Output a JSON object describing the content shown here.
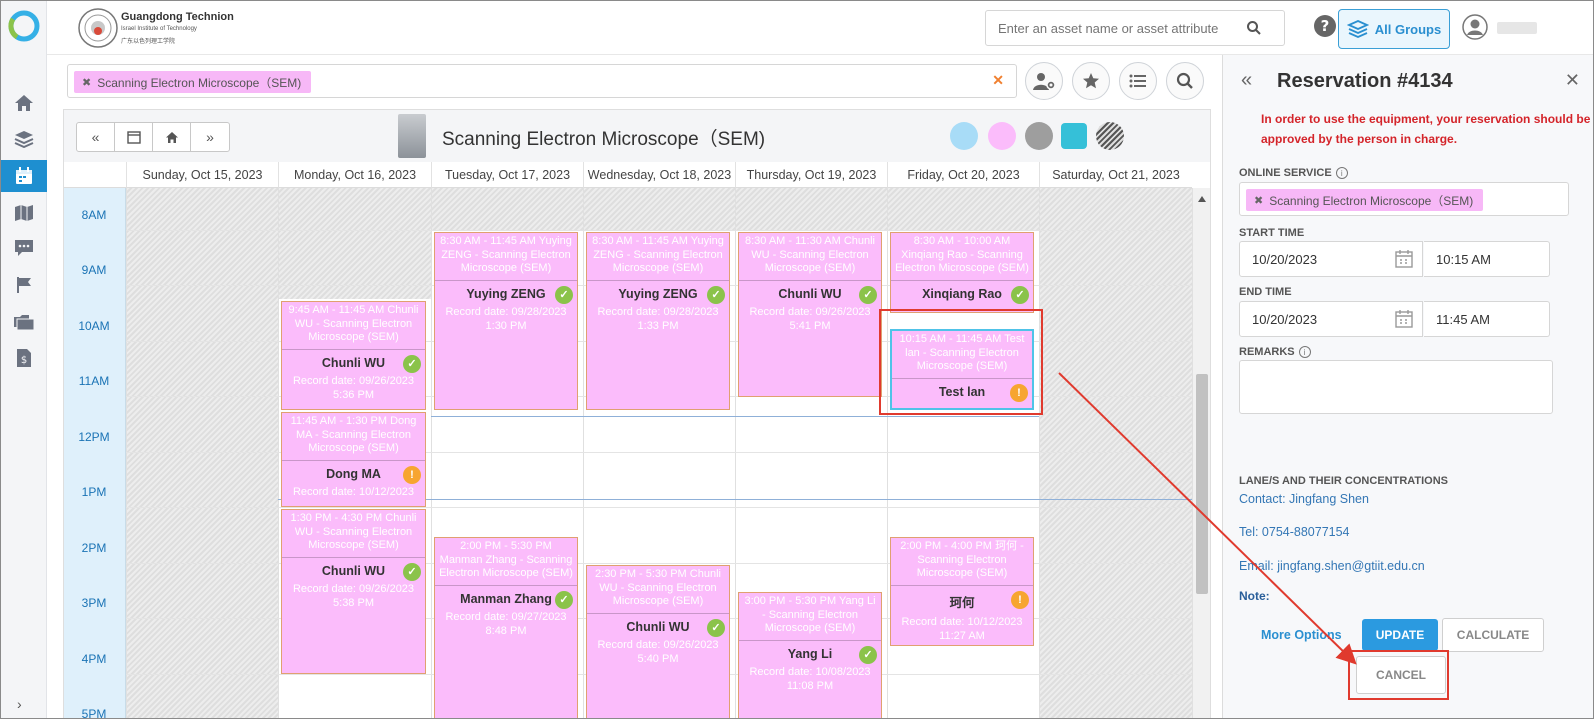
{
  "header": {
    "org_name": "Guangdong Technion",
    "org_sub1": "Israel Institute of Technology",
    "org_sub2": "广东以色列理工学院",
    "search_placeholder": "Enter an asset name or asset attribute",
    "groups_label": "All Groups"
  },
  "filter": {
    "chip_label": "Scanning Electron Microscope（SEM)"
  },
  "calendar": {
    "resource_title": "Scanning Electron Microscope（SEM)",
    "legend_colors": [
      "#a8dcf7",
      "#fbbcfb",
      "#9e9e9e",
      "#35c0d8",
      "#777777"
    ],
    "days": [
      "Sunday, Oct 15, 2023",
      "Monday, Oct 16, 2023",
      "Tuesday, Oct 17, 2023",
      "Wednesday, Oct 18, 2023",
      "Thursday, Oct 19, 2023",
      "Friday, Oct 20, 2023",
      "Saturday, Oct 21, 2023"
    ],
    "times": [
      "8AM",
      "9AM",
      "10AM",
      "11AM",
      "12PM",
      "1PM",
      "2PM",
      "3PM",
      "4PM",
      "5PM"
    ],
    "events": [
      {
        "day": 1,
        "start": 9.75,
        "end": 11.75,
        "header": "9:45 AM - 11:45 AM Chunli WU - Scanning Electron Microscope (SEM)",
        "name": "Chunli WU",
        "record": "Record date: 09/26/2023 5:36 PM",
        "status": "approved"
      },
      {
        "day": 1,
        "start": 11.75,
        "end": 13.5,
        "header": "11:45 AM - 1:30 PM Dong MA - Scanning Electron Microscope (SEM)",
        "name": "Dong MA",
        "record": "Record date: 10/12/2023",
        "status": "pending"
      },
      {
        "day": 1,
        "start": 13.5,
        "end": 16.5,
        "header": "1:30 PM - 4:30 PM Chunli WU - Scanning Electron Microscope (SEM)",
        "name": "Chunli WU",
        "record": "Record date: 09/26/2023 5:38 PM",
        "status": "approved"
      },
      {
        "day": 2,
        "start": 8.5,
        "end": 11.75,
        "header": "8:30 AM - 11:45 AM Yuying ZENG - Scanning Electron Microscope (SEM)",
        "name": "Yuying ZENG",
        "record": "Record date: 09/28/2023 1:30 PM",
        "status": "approved"
      },
      {
        "day": 2,
        "start": 14.0,
        "end": 17.5,
        "header": "2:00 PM - 5:30 PM Manman Zhang - Scanning Electron Microscope (SEM)",
        "name": "Manman Zhang",
        "record": "Record date: 09/27/2023 8:48 PM",
        "status": "approved"
      },
      {
        "day": 3,
        "start": 8.5,
        "end": 11.75,
        "header": "8:30 AM - 11:45 AM Yuying ZENG - Scanning Electron Microscope (SEM)",
        "name": "Yuying ZENG",
        "record": "Record date: 09/28/2023 1:33 PM",
        "status": "approved"
      },
      {
        "day": 3,
        "start": 14.5,
        "end": 17.5,
        "header": "2:30 PM - 5:30 PM Chunli WU - Scanning Electron Microscope (SEM)",
        "name": "Chunli WU",
        "record": "Record date: 09/26/2023 5:40 PM",
        "status": "approved"
      },
      {
        "day": 4,
        "start": 8.5,
        "end": 11.5,
        "header": "8:30 AM - 11:30 AM Chunli WU - Scanning Electron Microscope (SEM)",
        "name": "Chunli WU",
        "record": "Record date: 09/26/2023 5:41 PM",
        "status": "approved"
      },
      {
        "day": 4,
        "start": 15.0,
        "end": 17.5,
        "header": "3:00 PM - 5:30 PM Yang Li - Scanning Electron Microscope (SEM)",
        "name": "Yang Li",
        "record": "Record date: 10/08/2023 11:08 PM",
        "status": "approved"
      },
      {
        "day": 5,
        "start": 8.5,
        "end": 10.0,
        "header": "8:30 AM - 10:00 AM Xinqiang Rao - Scanning Electron Microscope (SEM)",
        "name": "Xinqiang Rao",
        "record": "",
        "status": "approved"
      },
      {
        "day": 5,
        "start": 10.25,
        "end": 11.75,
        "header": "10:15 AM - 11:45 AM Test lan - Scanning Electron Microscope (SEM)",
        "name": "Test lan",
        "record": "",
        "status": "pending",
        "selected": true
      },
      {
        "day": 5,
        "start": 14.0,
        "end": 16.0,
        "header": "2:00 PM - 4:00 PM 珂何 - Scanning Electron Microscope (SEM)",
        "name": "珂何",
        "record": "Record date: 10/12/2023 11:27 AM",
        "status": "pending"
      }
    ]
  },
  "reservation": {
    "title": "Reservation #4134",
    "notice": "In order to use the equipment, your reservation should be approved by the person in charge.",
    "online_service_label": "ONLINE SERVICE",
    "online_service_value": "Scanning Electron Microscope（SEM)",
    "start_time_label": "START TIME",
    "start_date": "10/20/2023",
    "start_time": "10:15 AM",
    "end_time_label": "END TIME",
    "end_date": "10/20/2023",
    "end_time": "11:45 AM",
    "remarks_label": "REMARKS",
    "lanes_label": "LANE/S AND THEIR CONCENTRATIONS",
    "contact": "Contact: Jingfang Shen",
    "tel": "Tel: 0754-88077154",
    "email": "Email: jingfang.shen@gtiit.edu.cn",
    "note": "Note:",
    "more_options": "More Options",
    "update": "UPDATE",
    "calculate": "CALCULATE",
    "cancel": "CANCEL"
  }
}
